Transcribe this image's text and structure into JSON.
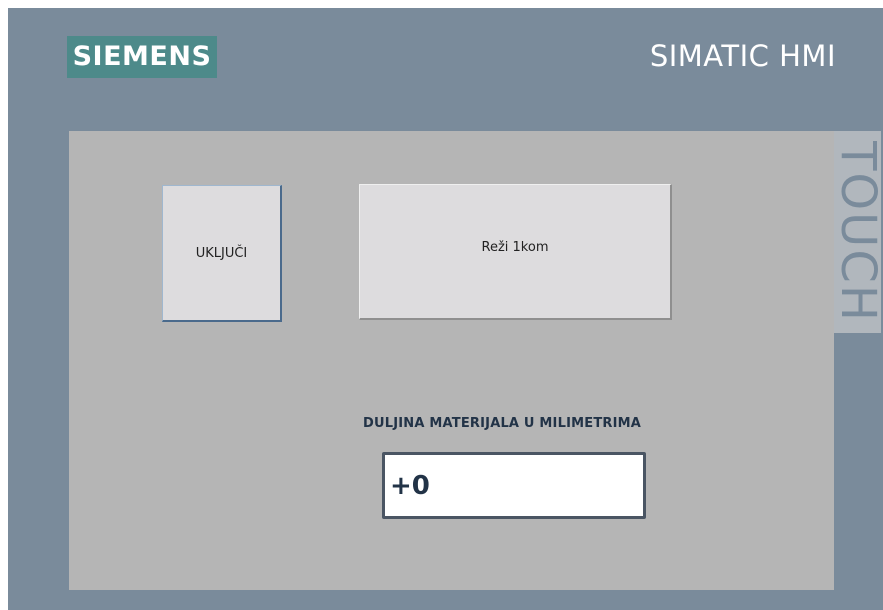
{
  "header": {
    "logo_text": "SIEMENS",
    "product_title": "SIMATIC HMI",
    "side_label": "TOUCH"
  },
  "screen": {
    "on_button_label": "UKLJUČI",
    "cut_button_label": "Reži 1kom",
    "length_label": "DULJINA MATERIJALA U MILIMETRIMA",
    "length_value": "+0"
  },
  "colors": {
    "frame": "#7a8b9b",
    "logo_bg": "#4d8a8a",
    "screen_bg": "#b5b5b5",
    "button_bg": "#dddcde",
    "label_text": "#223347"
  }
}
